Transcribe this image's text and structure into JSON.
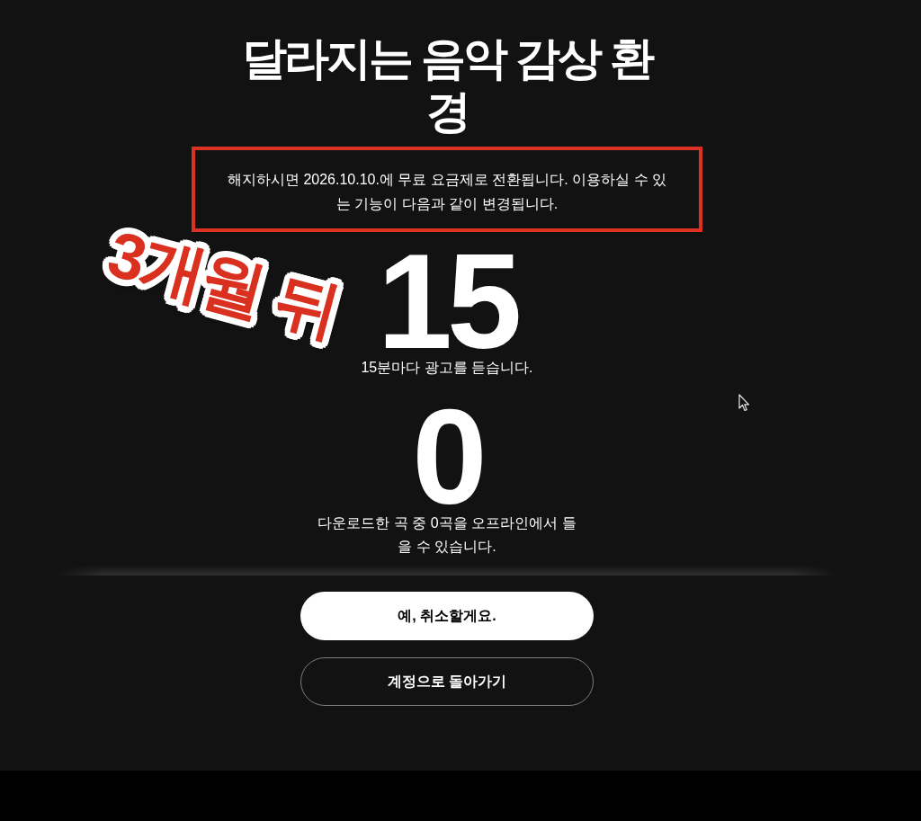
{
  "title": "달라지는 음악 감상 환경",
  "notice": {
    "text": "해지하시면 2026.10.10.에 무료 요금제로 전환됩니다. 이용하실 수 있는 기능이 다음과 같이 변경됩니다.",
    "highlighted": true
  },
  "sticker": {
    "text": "3개월 뒤"
  },
  "stats": [
    {
      "value": "15",
      "description": "15분마다 광고를 듣습니다."
    },
    {
      "value": "0",
      "description": "다운로드한 곡 중 0곡을 오프라인에서 들을 수 있습니다."
    }
  ],
  "buttons": [
    {
      "label": "예, 취소할게요.",
      "kind": "primary"
    },
    {
      "label": "계정으로 돌아가기",
      "kind": "secondary"
    }
  ]
}
